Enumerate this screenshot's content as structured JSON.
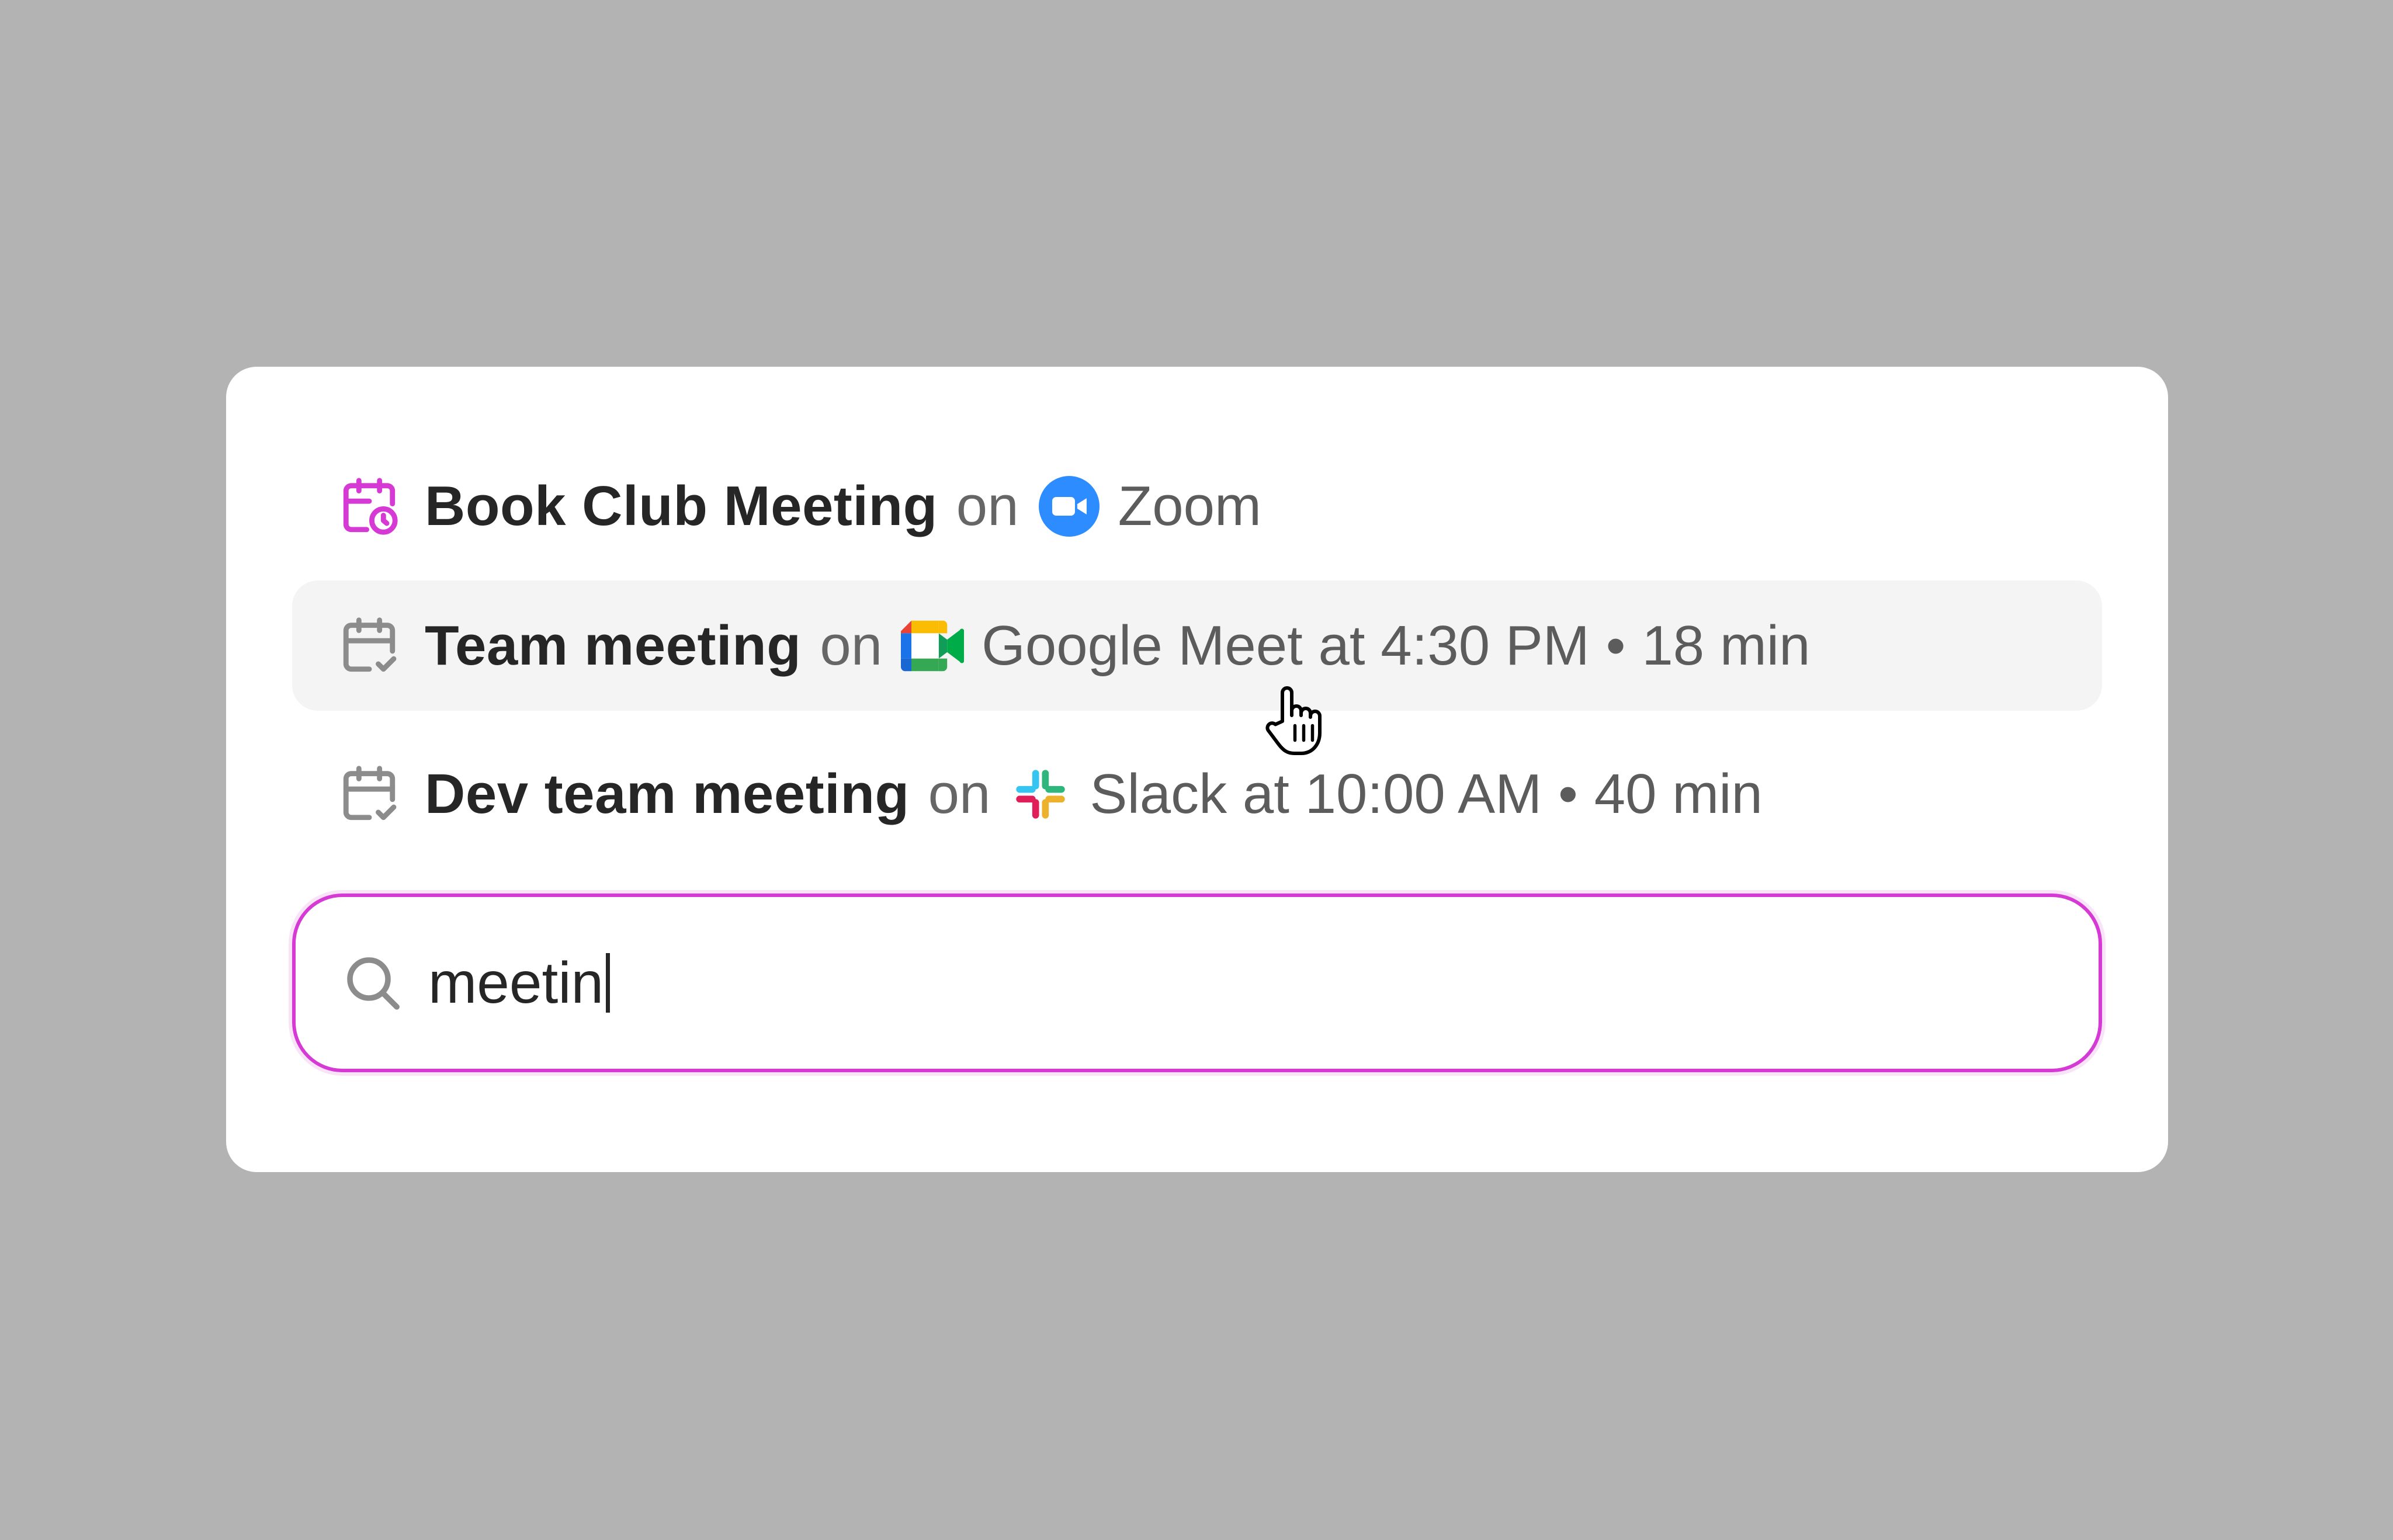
{
  "colors": {
    "accent": "#d63ad4",
    "background": "#b3b3b3",
    "card": "#ffffff",
    "highlight_row": "#f4f4f4",
    "zoom_blue": "#2d8cff"
  },
  "results": [
    {
      "icon": "calendar-clock-icon",
      "title": "Book Club Meeting",
      "on": "on",
      "app_icon": "zoom-logo-icon",
      "app": "Zoom"
    },
    {
      "icon": "calendar-check-icon",
      "title": "Team meeting",
      "on": "on",
      "app_icon": "google-meet-logo-icon",
      "app": "Google Meet at 4:30 PM",
      "separator": "•",
      "duration": "18 min",
      "highlighted": true
    },
    {
      "icon": "calendar-check-icon",
      "title": "Dev team meeting",
      "on": "on",
      "app_icon": "slack-logo-icon",
      "app": "Slack at 10:00 AM",
      "separator": "•",
      "duration": "40 min"
    }
  ],
  "search": {
    "icon": "search-icon",
    "value": "meetin"
  },
  "pointer": "hand-pointer-cursor-icon"
}
